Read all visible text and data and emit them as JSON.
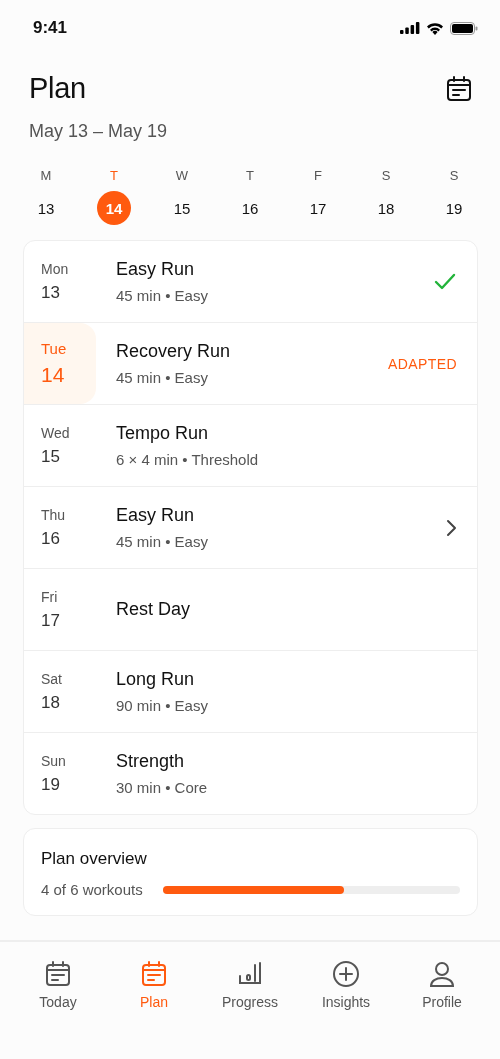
{
  "status_bar": {
    "time": "9:41"
  },
  "header": {
    "title": "Plan",
    "date_range": "May 13 – May 19"
  },
  "week": [
    {
      "letter": "M",
      "date": "13",
      "selected": false
    },
    {
      "letter": "T",
      "date": "14",
      "selected": true
    },
    {
      "letter": "W",
      "date": "15",
      "selected": false
    },
    {
      "letter": "T",
      "date": "16",
      "selected": false
    },
    {
      "letter": "F",
      "date": "17",
      "selected": false
    },
    {
      "letter": "S",
      "date": "18",
      "selected": false
    },
    {
      "letter": "S",
      "date": "19",
      "selected": false
    }
  ],
  "workouts": [
    {
      "day": "Mon",
      "date": "13",
      "title": "Easy Run",
      "detail": "45 min • Easy",
      "selected": false,
      "kind": "done"
    },
    {
      "day": "Tue",
      "date": "14",
      "title": "Recovery Run",
      "detail": "45 min • Easy",
      "selected": true,
      "kind": "adapted",
      "badge": "ADAPTED"
    },
    {
      "day": "Wed",
      "date": "15",
      "title": "Tempo Run",
      "detail": "6 × 4 min • Threshold",
      "selected": false,
      "kind": "plain"
    },
    {
      "day": "Thu",
      "date": "16",
      "title": "Easy Run",
      "detail": "45 min • Easy",
      "selected": false,
      "kind": "linked"
    },
    {
      "day": "Fri",
      "date": "17",
      "title": "Rest Day",
      "selected": false,
      "kind": "plain"
    },
    {
      "day": "Sat",
      "date": "18",
      "title": "Long Run",
      "detail": "90 min • Easy",
      "selected": false,
      "kind": "plain"
    },
    {
      "day": "Sun",
      "date": "19",
      "title": "Strength",
      "detail": "30 min • Core",
      "selected": false,
      "kind": "plain"
    }
  ],
  "overview": {
    "title": "Plan overview",
    "summary": "4 of 6 workouts",
    "level": 0.61
  },
  "tab_bar": [
    {
      "label": "Today",
      "selected": false
    },
    {
      "label": "Plan",
      "selected": true
    },
    {
      "label": "Progress",
      "selected": false
    },
    {
      "label": "Insights",
      "selected": false
    },
    {
      "label": "Profile",
      "selected": false
    }
  ]
}
